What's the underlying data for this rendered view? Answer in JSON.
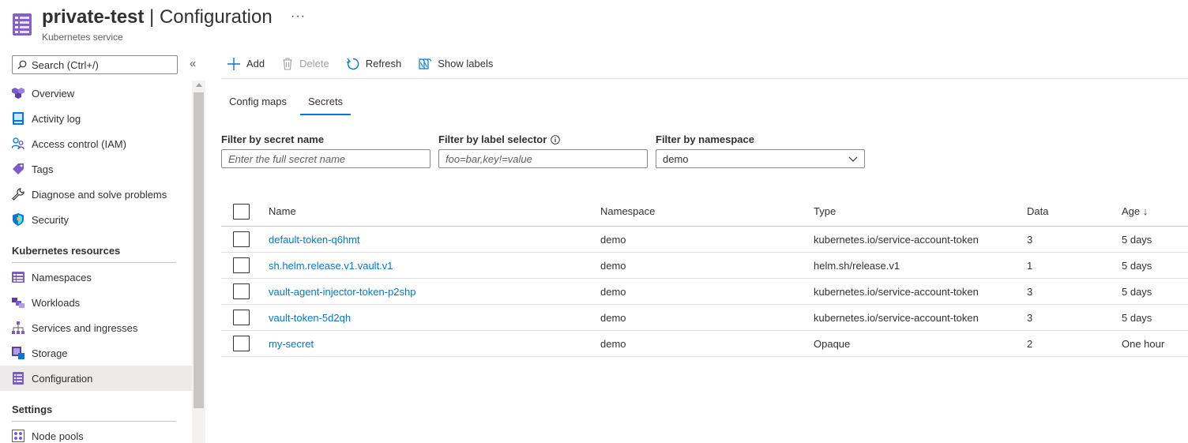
{
  "header": {
    "resource_name": "private-test",
    "separator": " | ",
    "page_title": "Configuration",
    "subtitle": "Kubernetes service",
    "more": "···"
  },
  "sidebar": {
    "search_placeholder": "Search (Ctrl+/)",
    "collapse": "«",
    "items_top": [
      {
        "label": "Overview",
        "icon": "overview-icon"
      },
      {
        "label": "Activity log",
        "icon": "activity-log-icon"
      },
      {
        "label": "Access control (IAM)",
        "icon": "access-control-icon"
      },
      {
        "label": "Tags",
        "icon": "tag-icon"
      },
      {
        "label": "Diagnose and solve problems",
        "icon": "wrench-icon"
      },
      {
        "label": "Security",
        "icon": "shield-icon"
      }
    ],
    "section_k8s": "Kubernetes resources",
    "items_k8s": [
      {
        "label": "Namespaces",
        "icon": "namespaces-icon"
      },
      {
        "label": "Workloads",
        "icon": "workloads-icon"
      },
      {
        "label": "Services and ingresses",
        "icon": "services-icon"
      },
      {
        "label": "Storage",
        "icon": "storage-icon"
      },
      {
        "label": "Configuration",
        "icon": "configuration-icon",
        "active": true
      }
    ],
    "section_settings": "Settings",
    "items_settings": [
      {
        "label": "Node pools",
        "icon": "node-pools-icon"
      }
    ]
  },
  "toolbar": {
    "add": "Add",
    "delete": "Delete",
    "refresh": "Refresh",
    "show_labels": "Show labels"
  },
  "tabs": [
    "Config maps",
    "Secrets"
  ],
  "active_tab": "Secrets",
  "filters": {
    "secret_name_label": "Filter by secret name",
    "secret_name_placeholder": "Enter the full secret name",
    "label_selector_label": "Filter by label selector",
    "label_selector_placeholder": "foo=bar,key!=value",
    "namespace_label": "Filter by namespace",
    "namespace_value": "demo"
  },
  "table": {
    "columns": {
      "name": "Name",
      "namespace": "Namespace",
      "type": "Type",
      "data": "Data",
      "age": "Age ↓"
    },
    "rows": [
      {
        "name": "default-token-q6hmt",
        "namespace": "demo",
        "type": "kubernetes.io/service-account-token",
        "data": "3",
        "age": "5 days"
      },
      {
        "name": "sh.helm.release.v1.vault.v1",
        "namespace": "demo",
        "type": "helm.sh/release.v1",
        "data": "1",
        "age": "5 days"
      },
      {
        "name": "vault-agent-injector-token-p2shp",
        "namespace": "demo",
        "type": "kubernetes.io/service-account-token",
        "data": "3",
        "age": "5 days"
      },
      {
        "name": "vault-token-5d2qh",
        "namespace": "demo",
        "type": "kubernetes.io/service-account-token",
        "data": "3",
        "age": "5 days"
      },
      {
        "name": "my-secret",
        "namespace": "demo",
        "type": "Opaque",
        "data": "2",
        "age": "One hour"
      }
    ]
  },
  "colors": {
    "accent": "#0078d4",
    "brand_purple": "#7a5cc8"
  }
}
